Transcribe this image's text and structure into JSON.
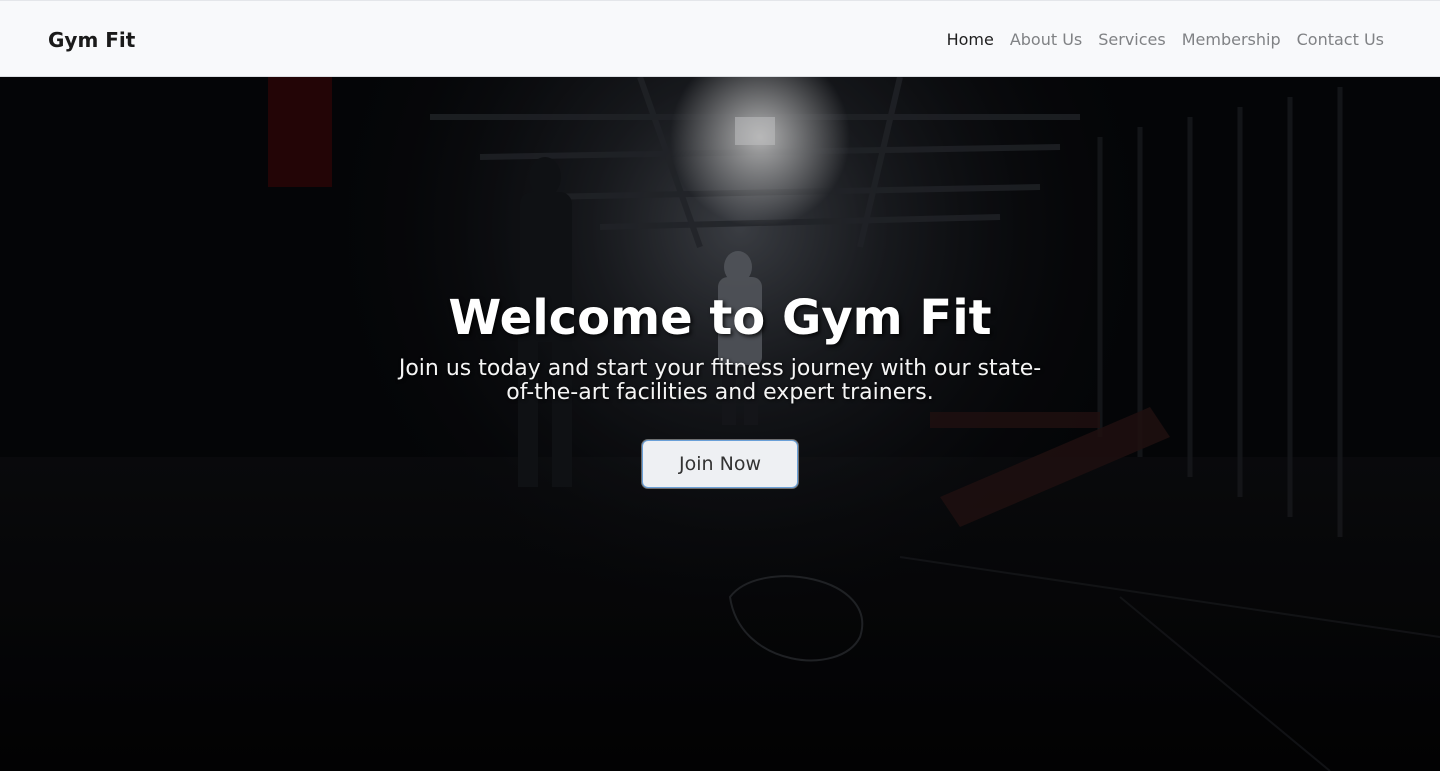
{
  "navbar": {
    "brand": "Gym Fit",
    "links": [
      {
        "label": "Home",
        "active": true
      },
      {
        "label": "About Us",
        "active": false
      },
      {
        "label": "Services",
        "active": false
      },
      {
        "label": "Membership",
        "active": false
      },
      {
        "label": "Contact Us",
        "active": false
      }
    ]
  },
  "hero": {
    "title": "Welcome to Gym Fit",
    "subtitle": "Join us today and start your fitness journey with our state-of-the-art facilities and expert trainers.",
    "button_label": "Join Now"
  },
  "colors": {
    "navbar_bg": "#f8f9fb",
    "hero_bg": "#06070a",
    "button_border": "#6aa0d8"
  }
}
